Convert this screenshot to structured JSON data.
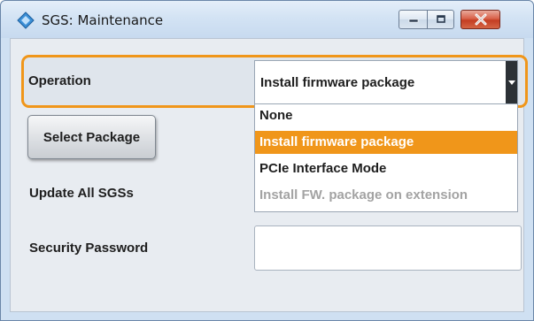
{
  "window": {
    "title": "SGS: Maintenance"
  },
  "operation": {
    "label": "Operation",
    "selected_value": "Install firmware package",
    "options": [
      {
        "label": "None",
        "state": "normal"
      },
      {
        "label": "Install firmware package",
        "state": "selected"
      },
      {
        "label": "PCIe Interface Mode",
        "state": "normal"
      },
      {
        "label": "Install FW. package on extension",
        "state": "disabled"
      }
    ]
  },
  "buttons": {
    "select_package": "Select Package"
  },
  "fields": {
    "update_all_label": "Update All SGSs",
    "password_label": "Security Password",
    "password_value": ""
  },
  "colors": {
    "accent": "#f0961a",
    "close_button": "#c43d22",
    "panel_bg": "#e8ecf1"
  },
  "icons": {
    "app": "sgs-app-icon",
    "minimize": "minimize-icon",
    "maximize": "maximize-icon",
    "close": "close-icon",
    "dropdown": "chevron-down-icon"
  }
}
